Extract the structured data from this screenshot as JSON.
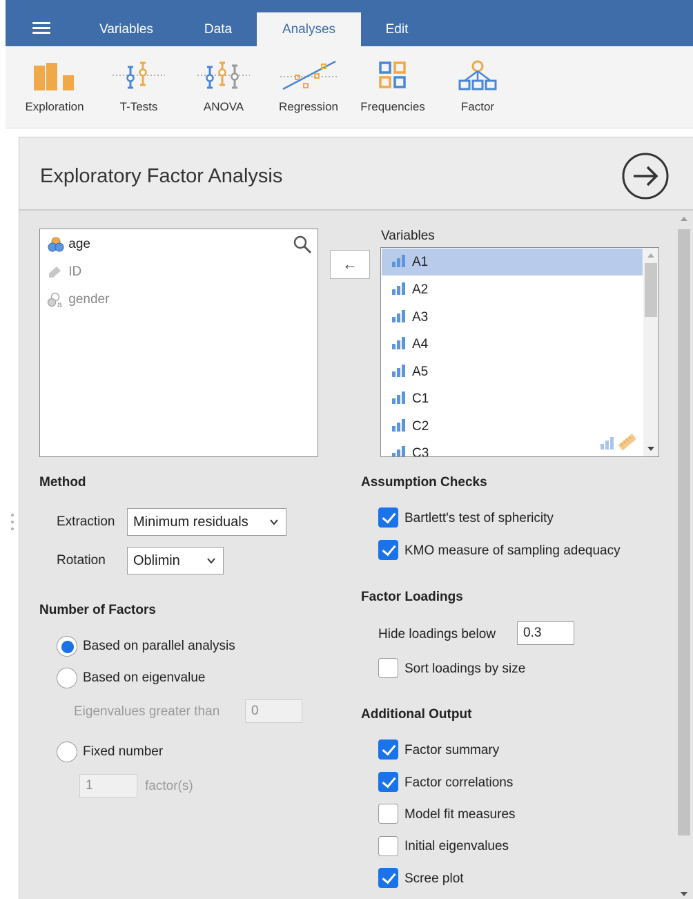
{
  "menu": {
    "tabs": [
      {
        "label": "Variables"
      },
      {
        "label": "Data"
      },
      {
        "label": "Analyses"
      },
      {
        "label": "Edit"
      }
    ]
  },
  "ribbon": {
    "items": [
      {
        "label": "Exploration",
        "icon": "exploration-icon"
      },
      {
        "label": "T-Tests",
        "icon": "t-tests-icon"
      },
      {
        "label": "ANOVA",
        "icon": "anova-icon"
      },
      {
        "label": "Regression",
        "icon": "regression-icon"
      },
      {
        "label": "Frequencies",
        "icon": "frequencies-icon"
      },
      {
        "label": "Factor",
        "icon": "factor-icon"
      }
    ]
  },
  "panel": {
    "title": "Exploratory Factor Analysis"
  },
  "source_list": {
    "items": [
      {
        "name": "age",
        "type": "continuous"
      },
      {
        "name": "ID",
        "type": "id"
      },
      {
        "name": "gender",
        "type": "nominal-text"
      }
    ]
  },
  "move_button": {
    "label": "←"
  },
  "variables": {
    "label": "Variables",
    "items": [
      "A1",
      "A2",
      "A3",
      "A4",
      "A5",
      "C1",
      "C2",
      "C3"
    ],
    "selected": "A1"
  },
  "method": {
    "heading": "Method",
    "extraction_label": "Extraction",
    "extraction_value": "Minimum residuals",
    "rotation_label": "Rotation",
    "rotation_value": "Oblimin"
  },
  "num_factors": {
    "heading": "Number of Factors",
    "parallel_label": "Based on parallel analysis",
    "eigen_label": "Based on eigenvalue",
    "eigen_gt_label": "Eigenvalues greater than",
    "eigen_gt_value": "0",
    "fixed_label": "Fixed number",
    "fixed_value": "1",
    "fixed_unit": "factor(s)",
    "selected": "parallel"
  },
  "assumption": {
    "heading": "Assumption Checks",
    "bartlett_label": "Bartlett's test of sphericity",
    "bartlett_checked": true,
    "kmo_label": "KMO measure of sampling adequacy",
    "kmo_checked": true
  },
  "loadings": {
    "heading": "Factor Loadings",
    "hide_label": "Hide loadings below",
    "hide_value": "0.3",
    "sort_label": "Sort loadings by size",
    "sort_checked": false
  },
  "additional": {
    "heading": "Additional Output",
    "items": [
      {
        "label": "Factor summary",
        "checked": true
      },
      {
        "label": "Factor correlations",
        "checked": true
      },
      {
        "label": "Model fit measures",
        "checked": false
      },
      {
        "label": "Initial eigenvalues",
        "checked": false
      },
      {
        "label": "Scree plot",
        "checked": true
      }
    ]
  },
  "colors": {
    "menu_bg": "#3e6da9",
    "accent": "#1a73e8",
    "icon_orange": "#f0a848",
    "icon_blue": "#4a86d6",
    "selection": "#b9cbeb"
  }
}
